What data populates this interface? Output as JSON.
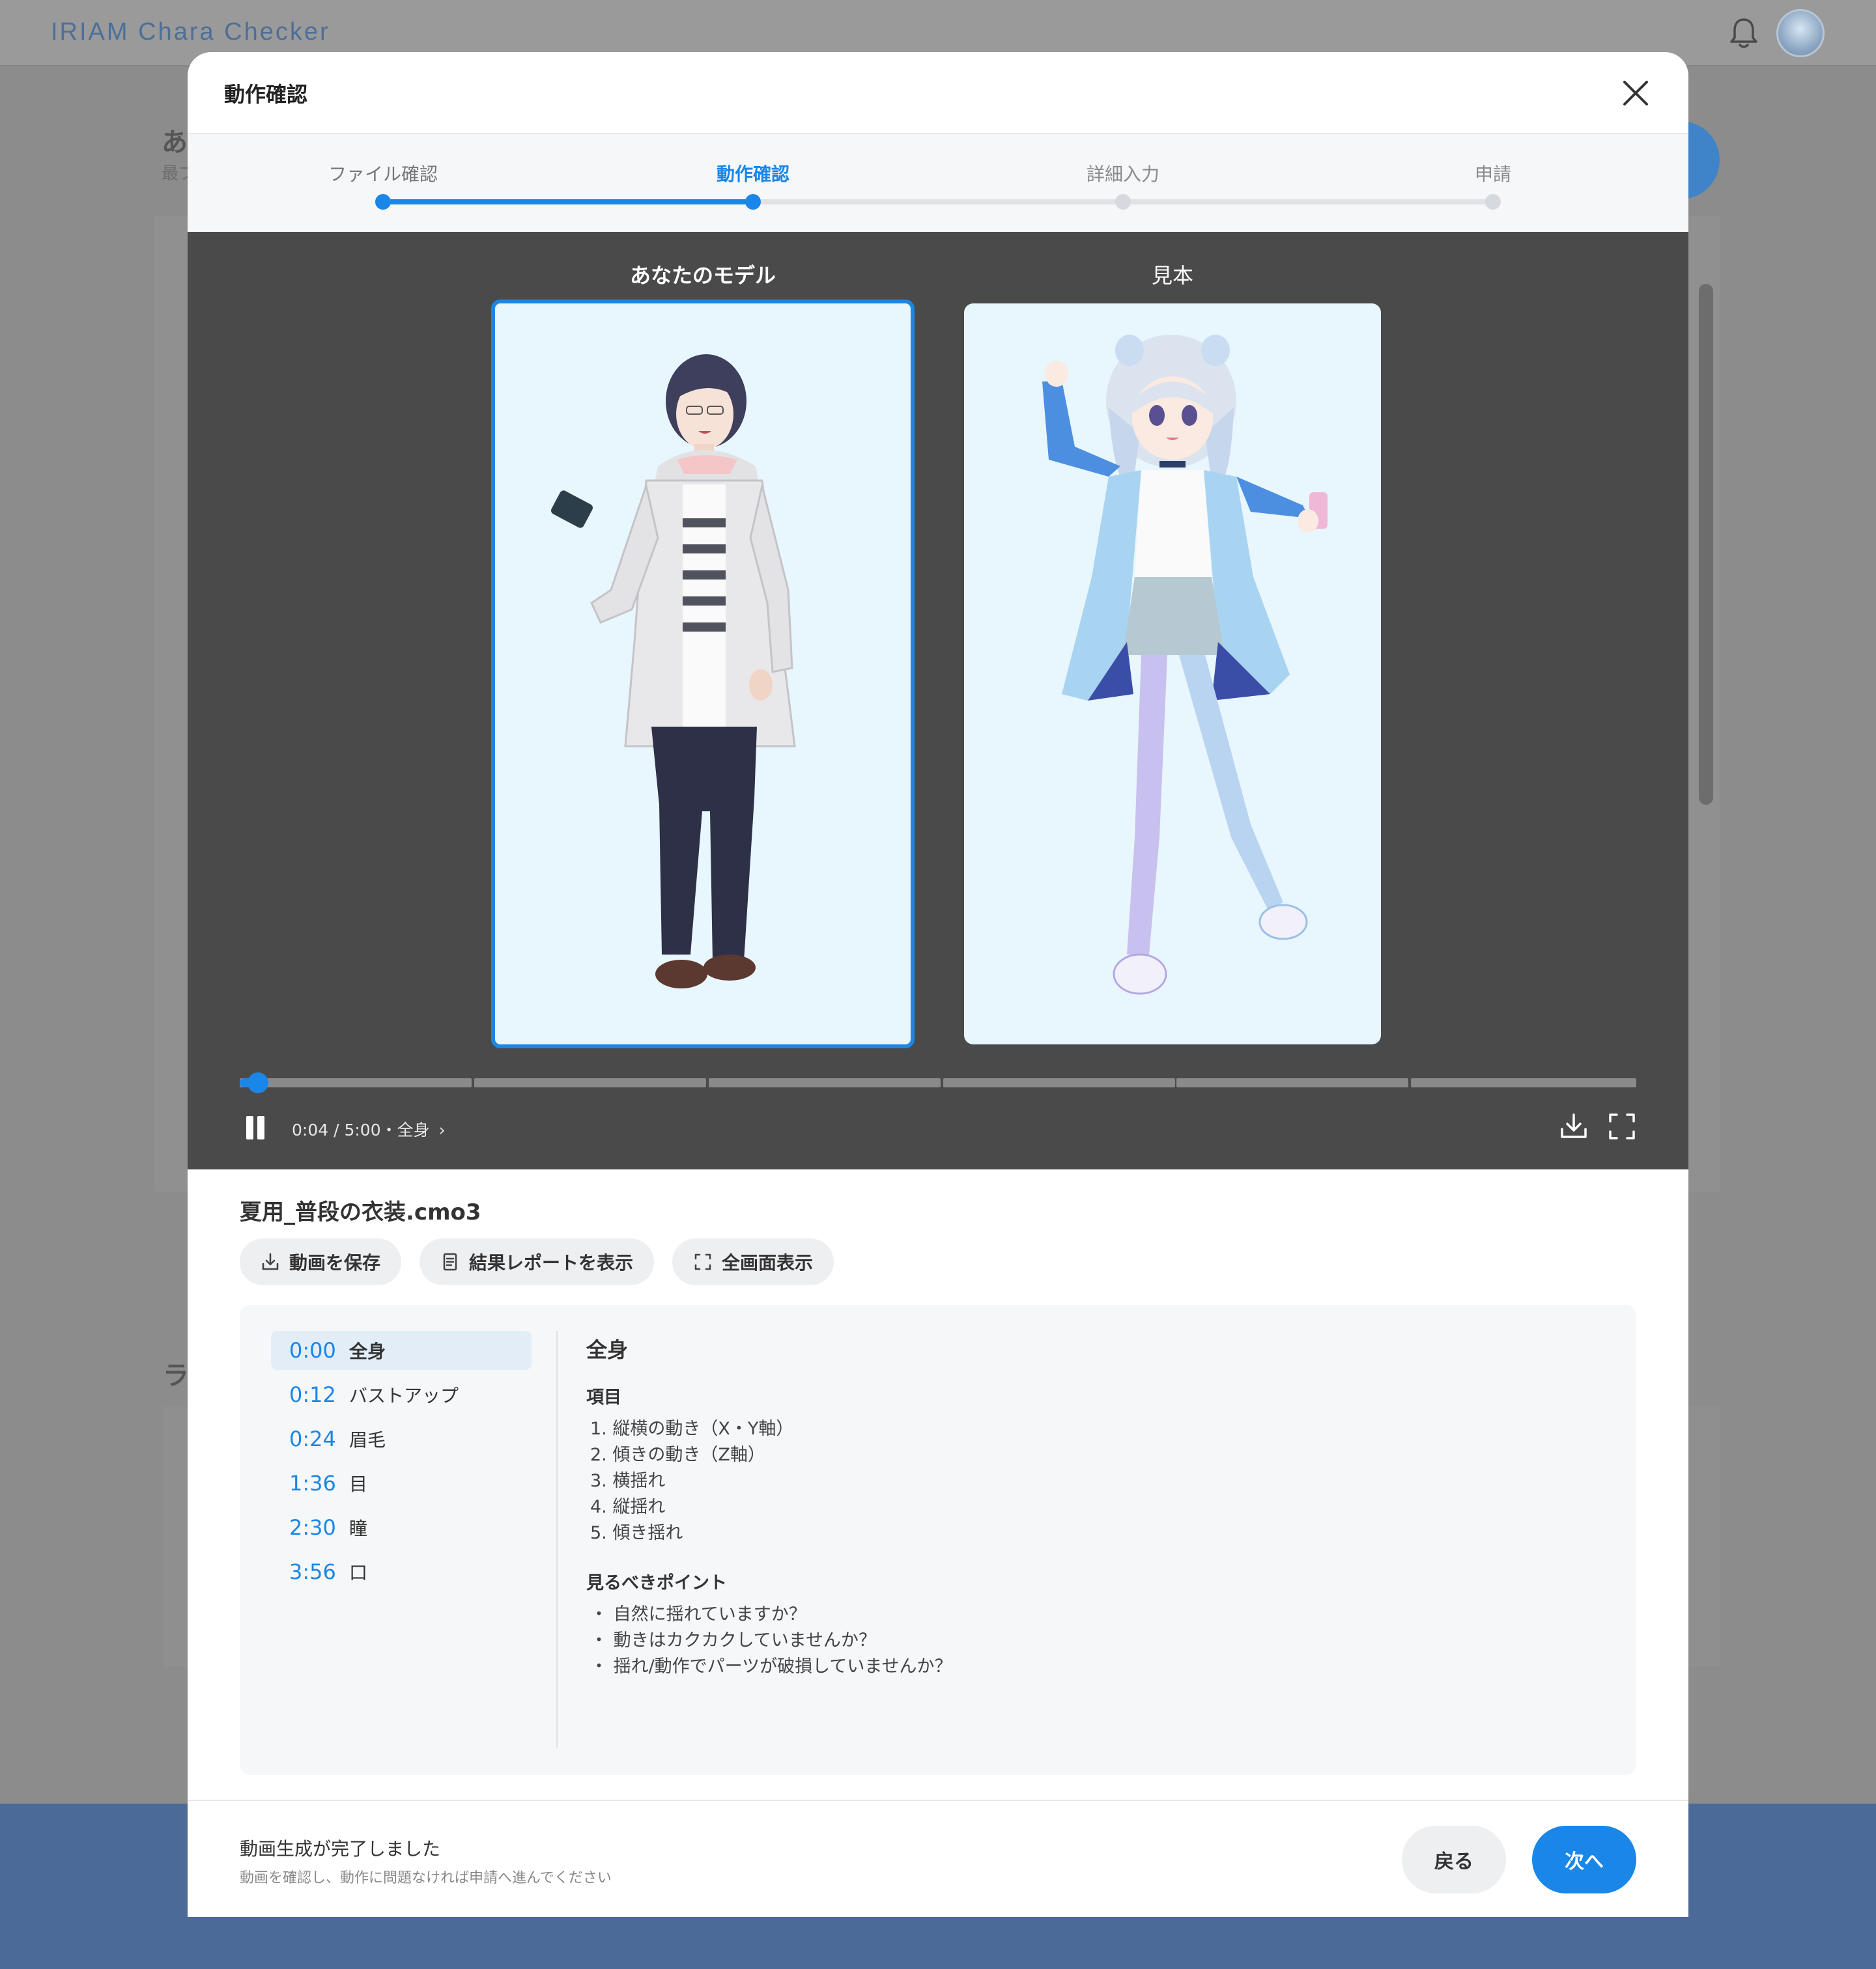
{
  "app": {
    "logo": "IRIAM Chara Checker",
    "bg_heading": "あ",
    "bg_sub": "最ブ",
    "bg_section": "ラ"
  },
  "modal": {
    "title": "動作確認"
  },
  "steps": [
    {
      "label": "ファイル確認",
      "state": "done"
    },
    {
      "label": "動作確認",
      "state": "active"
    },
    {
      "label": "詳細入力",
      "state": "pending"
    },
    {
      "label": "申請",
      "state": "pending"
    }
  ],
  "player": {
    "left_title": "あなたのモデル",
    "right_title": "見本",
    "left_image": "male-character-illustration",
    "right_image": "female-character-illustration",
    "progress_fraction": 0.013,
    "segments": 6,
    "time": "0:04 / 5:00・全身"
  },
  "file": {
    "name": "夏用_普段の衣装.cmo3",
    "actions": [
      {
        "label": "動画を保存",
        "icon": "download-icon"
      },
      {
        "label": "結果レポートを表示",
        "icon": "document-icon"
      },
      {
        "label": "全画面表示",
        "icon": "fullscreen-icon"
      }
    ]
  },
  "chapters": [
    {
      "time": "0:00",
      "label": "全身",
      "active": true
    },
    {
      "time": "0:12",
      "label": "バストアップ",
      "active": false
    },
    {
      "time": "0:24",
      "label": "眉毛",
      "active": false
    },
    {
      "time": "1:36",
      "label": "目",
      "active": false
    },
    {
      "time": "2:30",
      "label": "瞳",
      "active": false
    },
    {
      "time": "3:56",
      "label": "口",
      "active": false
    }
  ],
  "detail": {
    "title": "全身",
    "items_heading": "項目",
    "items": [
      "1. 縦横の動き（X・Y軸）",
      "2. 傾きの動き（Z軸）",
      "3. 横揺れ",
      "4. 縦揺れ",
      "5. 傾き揺れ"
    ],
    "points_heading": "見るべきポイント",
    "points": [
      "・ 自然に揺れていますか？",
      "・ 動きはカクカクしていませんか？",
      "・ 揺れ/動作でパーツが破損していませんか？"
    ]
  },
  "footer": {
    "status": "動画生成が完了しました",
    "hint": "動画を確認し、動作に問題なければ申請へ進んでください",
    "back": "戻る",
    "next": "次へ"
  },
  "colors": {
    "accent": "#1a86e8",
    "player_bg": "#4a4a4a",
    "pane_bg": "#e8f6fd"
  }
}
